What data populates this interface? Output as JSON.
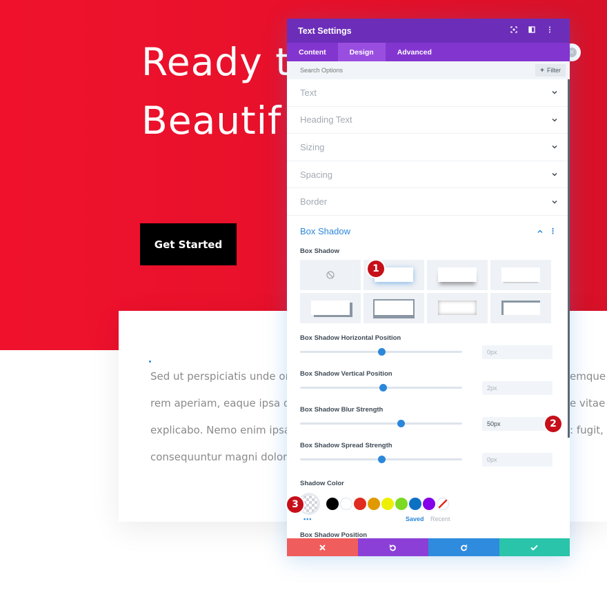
{
  "hero": {
    "title_line1": "Ready t",
    "title_line2": "Beautif",
    "cta_label": "Get Started"
  },
  "card": {
    "lines_left": [
      "Sed ut perspiciatis unde or",
      "rem aperiam, eaque ipsa q",
      "explicabo. Nemo enim ipsa",
      "consequuntur magni dolore"
    ],
    "lines_right": [
      "emque",
      "e vitae c",
      ": fugit, s"
    ]
  },
  "modal": {
    "title": "Text Settings",
    "header_icons": [
      "focus-icon",
      "split-view-icon",
      "more-icon"
    ],
    "tabs": [
      {
        "label": "Content"
      },
      {
        "label": "Design"
      },
      {
        "label": "Advanced"
      }
    ],
    "active_tab": "Design",
    "search_placeholder": "Search Options",
    "filter_label": "Filter",
    "sections": [
      {
        "label": "Text"
      },
      {
        "label": "Heading Text"
      },
      {
        "label": "Sizing"
      },
      {
        "label": "Spacing"
      },
      {
        "label": "Border"
      }
    ],
    "open_section": {
      "label": "Box Shadow",
      "preset_label": "Box Shadow",
      "sliders": [
        {
          "label": "Box Shadow Horizontal Position",
          "value": "0px",
          "level": 0.5
        },
        {
          "label": "Box Shadow Vertical Position",
          "value": "2px",
          "level": 0.51
        },
        {
          "label": "Box Shadow Blur Strength",
          "value": "50px",
          "level": 0.62
        },
        {
          "label": "Box Shadow Spread Strength",
          "value": "0px",
          "level": 0.5
        }
      ],
      "color_label": "Shadow Color",
      "swatches": [
        "#000000",
        "#ffffff",
        "#e02b20",
        "#e09900",
        "#edf000",
        "#7cda24",
        "#0c71c3",
        "#8300e9"
      ],
      "saved_label": "Saved",
      "recent_label": "Recent",
      "next_label": "Box Shadow Position"
    },
    "footer_colors": [
      "#ef5d5c",
      "#8b3fd6",
      "#2f8bdd",
      "#29c4a9"
    ]
  },
  "badges": [
    "1",
    "2",
    "3"
  ]
}
